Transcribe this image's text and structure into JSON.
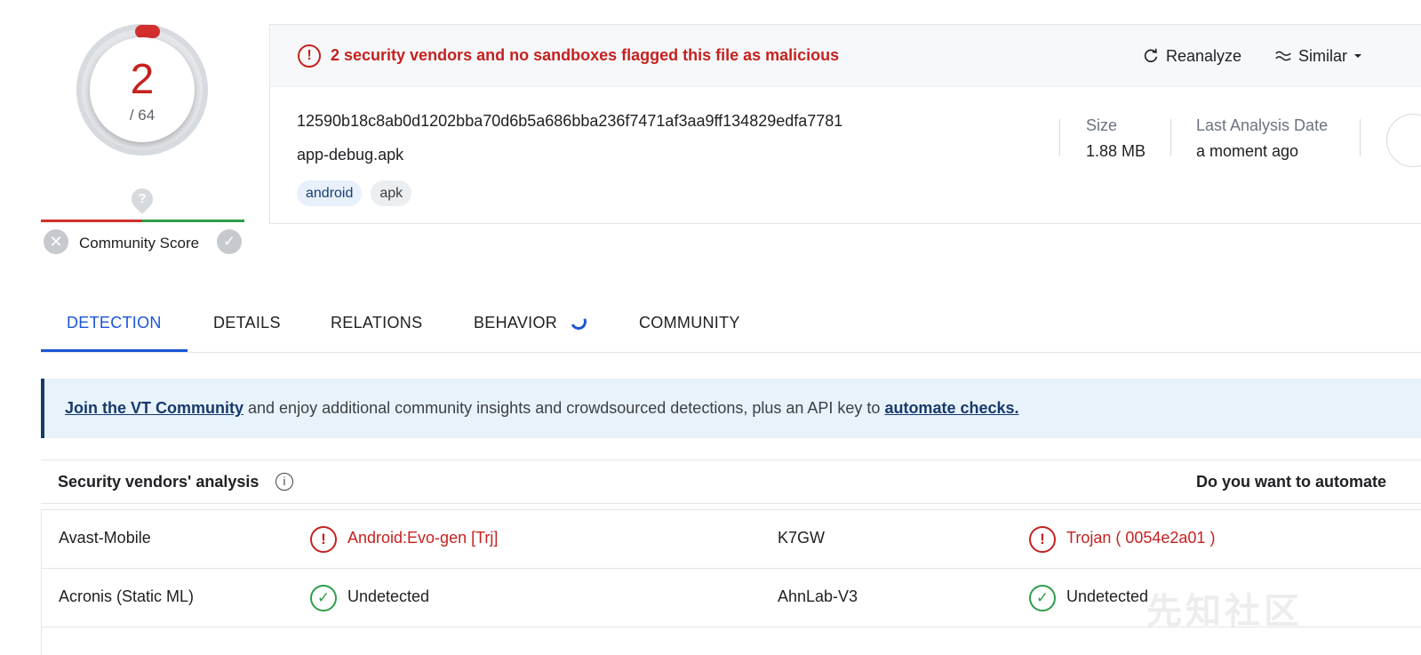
{
  "score": {
    "detections": "2",
    "total": "/ 64",
    "community_label": "Community Score",
    "community_icon": "question-pin-icon"
  },
  "header": {
    "alert_text": "2 security vendors and no sandboxes flagged this file as malicious",
    "reanalyze_label": "Reanalyze",
    "similar_label": "Similar",
    "hash": "12590b18c8ab0d1202bba70d6b5a686bba236f7471af3aa9ff134829edfa7781",
    "filename": "app-debug.apk",
    "tags": [
      "android",
      "apk"
    ],
    "size_label": "Size",
    "size_value": "1.88 MB",
    "date_label": "Last Analysis Date",
    "date_value": "a moment ago"
  },
  "tabs": [
    "DETECTION",
    "DETAILS",
    "RELATIONS",
    "BEHAVIOR",
    "COMMUNITY"
  ],
  "banner": {
    "link1": "Join the VT Community",
    "middle": " and enjoy additional community insights and crowdsourced detections, plus an API key to ",
    "link2": "automate checks."
  },
  "vendors": {
    "title": "Security vendors' analysis",
    "automate_question": "Do you want to automate",
    "rows": [
      {
        "v1": "Avast-Mobile",
        "r1": "Android:Evo-gen [Trj]",
        "s1": "bad",
        "v2": "K7GW",
        "r2": "Trojan ( 0054e2a01 )",
        "s2": "bad"
      },
      {
        "v1": "Acronis (Static ML)",
        "r1": "Undetected",
        "s1": "ok",
        "v2": "AhnLab-V3",
        "r2": "Undetected",
        "s2": "ok"
      }
    ]
  },
  "watermark": "先知社区",
  "colors": {
    "malicious": "#c5221f",
    "clean": "#2e9d4a",
    "accent": "#1a56d6",
    "banner_bg": "#e8f2fb"
  }
}
